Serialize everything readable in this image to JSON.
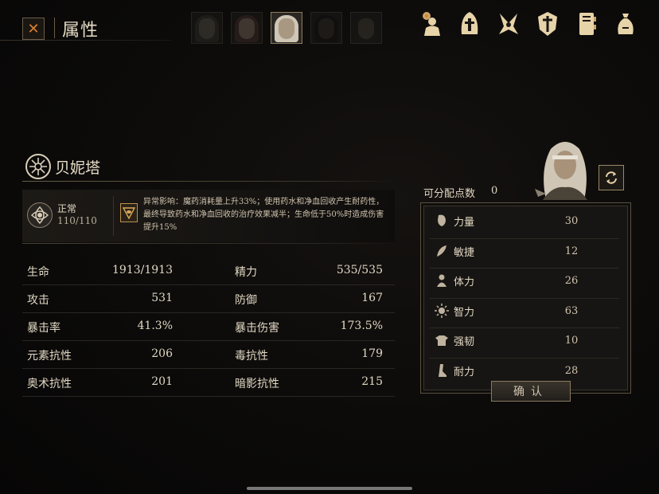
{
  "header": {
    "close_icon": "close-x-icon",
    "title": "属性"
  },
  "portraits": [
    {
      "name": "portrait-1",
      "active": false
    },
    {
      "name": "portrait-2",
      "active": false
    },
    {
      "name": "portrait-3",
      "active": true
    },
    {
      "name": "portrait-4",
      "active": false
    },
    {
      "name": "portrait-5",
      "active": false
    }
  ],
  "top_icons": [
    "character-icon",
    "helmet-icon",
    "skill-icon",
    "shield-icon",
    "journal-icon",
    "bag-icon"
  ],
  "character": {
    "name": "贝妮塔"
  },
  "status": {
    "label": "正常",
    "value": "110/110",
    "effect_text": "异常影响：魔药消耗量上升33%；使用药水和净血回收产生耐药性，最终导致药水和净血回收的治疗效果减半；生命低于50%时造成伤害提升15%"
  },
  "stats": [
    {
      "k1": "生命",
      "v1": "1913/1913",
      "k2": "精力",
      "v2": "535/535"
    },
    {
      "k1": "攻击",
      "v1": "531",
      "k2": "防御",
      "v2": "167"
    },
    {
      "k1": "暴击率",
      "v1": "41.3%",
      "k2": "暴击伤害",
      "v2": "173.5%"
    },
    {
      "k1": "元素抗性",
      "v1": "206",
      "k2": "毒抗性",
      "v2": "179"
    },
    {
      "k1": "奥术抗性",
      "v1": "201",
      "k2": "暗影抗性",
      "v2": "215"
    }
  ],
  "points": {
    "label": "可分配点数",
    "value": "0"
  },
  "attributes": [
    {
      "label": "力量",
      "value": "30",
      "icon": "fist-icon"
    },
    {
      "label": "敏捷",
      "value": "12",
      "icon": "feather-icon"
    },
    {
      "label": "体力",
      "value": "26",
      "icon": "body-icon"
    },
    {
      "label": "智力",
      "value": "63",
      "icon": "sun-icon"
    },
    {
      "label": "强韧",
      "value": "10",
      "icon": "armor-icon"
    },
    {
      "label": "耐力",
      "value": "28",
      "icon": "leg-icon"
    }
  ],
  "confirm_label": "确认",
  "colors": {
    "accent": "#d9802e",
    "gold": "#c9a56a",
    "text": "#e0d6c2"
  }
}
